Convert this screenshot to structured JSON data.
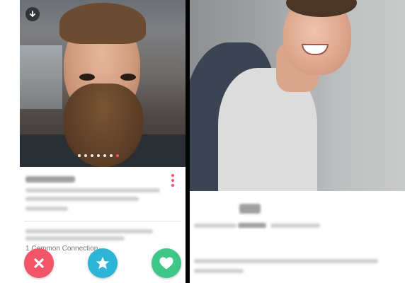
{
  "left_card": {
    "connection_text": "1 Common Connection",
    "photo_count": 7,
    "active_photo_index": 6,
    "icons": {
      "download": "download-icon",
      "menu": "more-vertical-icon",
      "nope": "x-icon",
      "super_like": "star-icon",
      "like": "heart-icon"
    }
  },
  "colors": {
    "nope": "#f25468",
    "super_like": "#2db5d8",
    "like": "#3fc78a",
    "accent": "#fd5068",
    "separator": "#050505"
  }
}
